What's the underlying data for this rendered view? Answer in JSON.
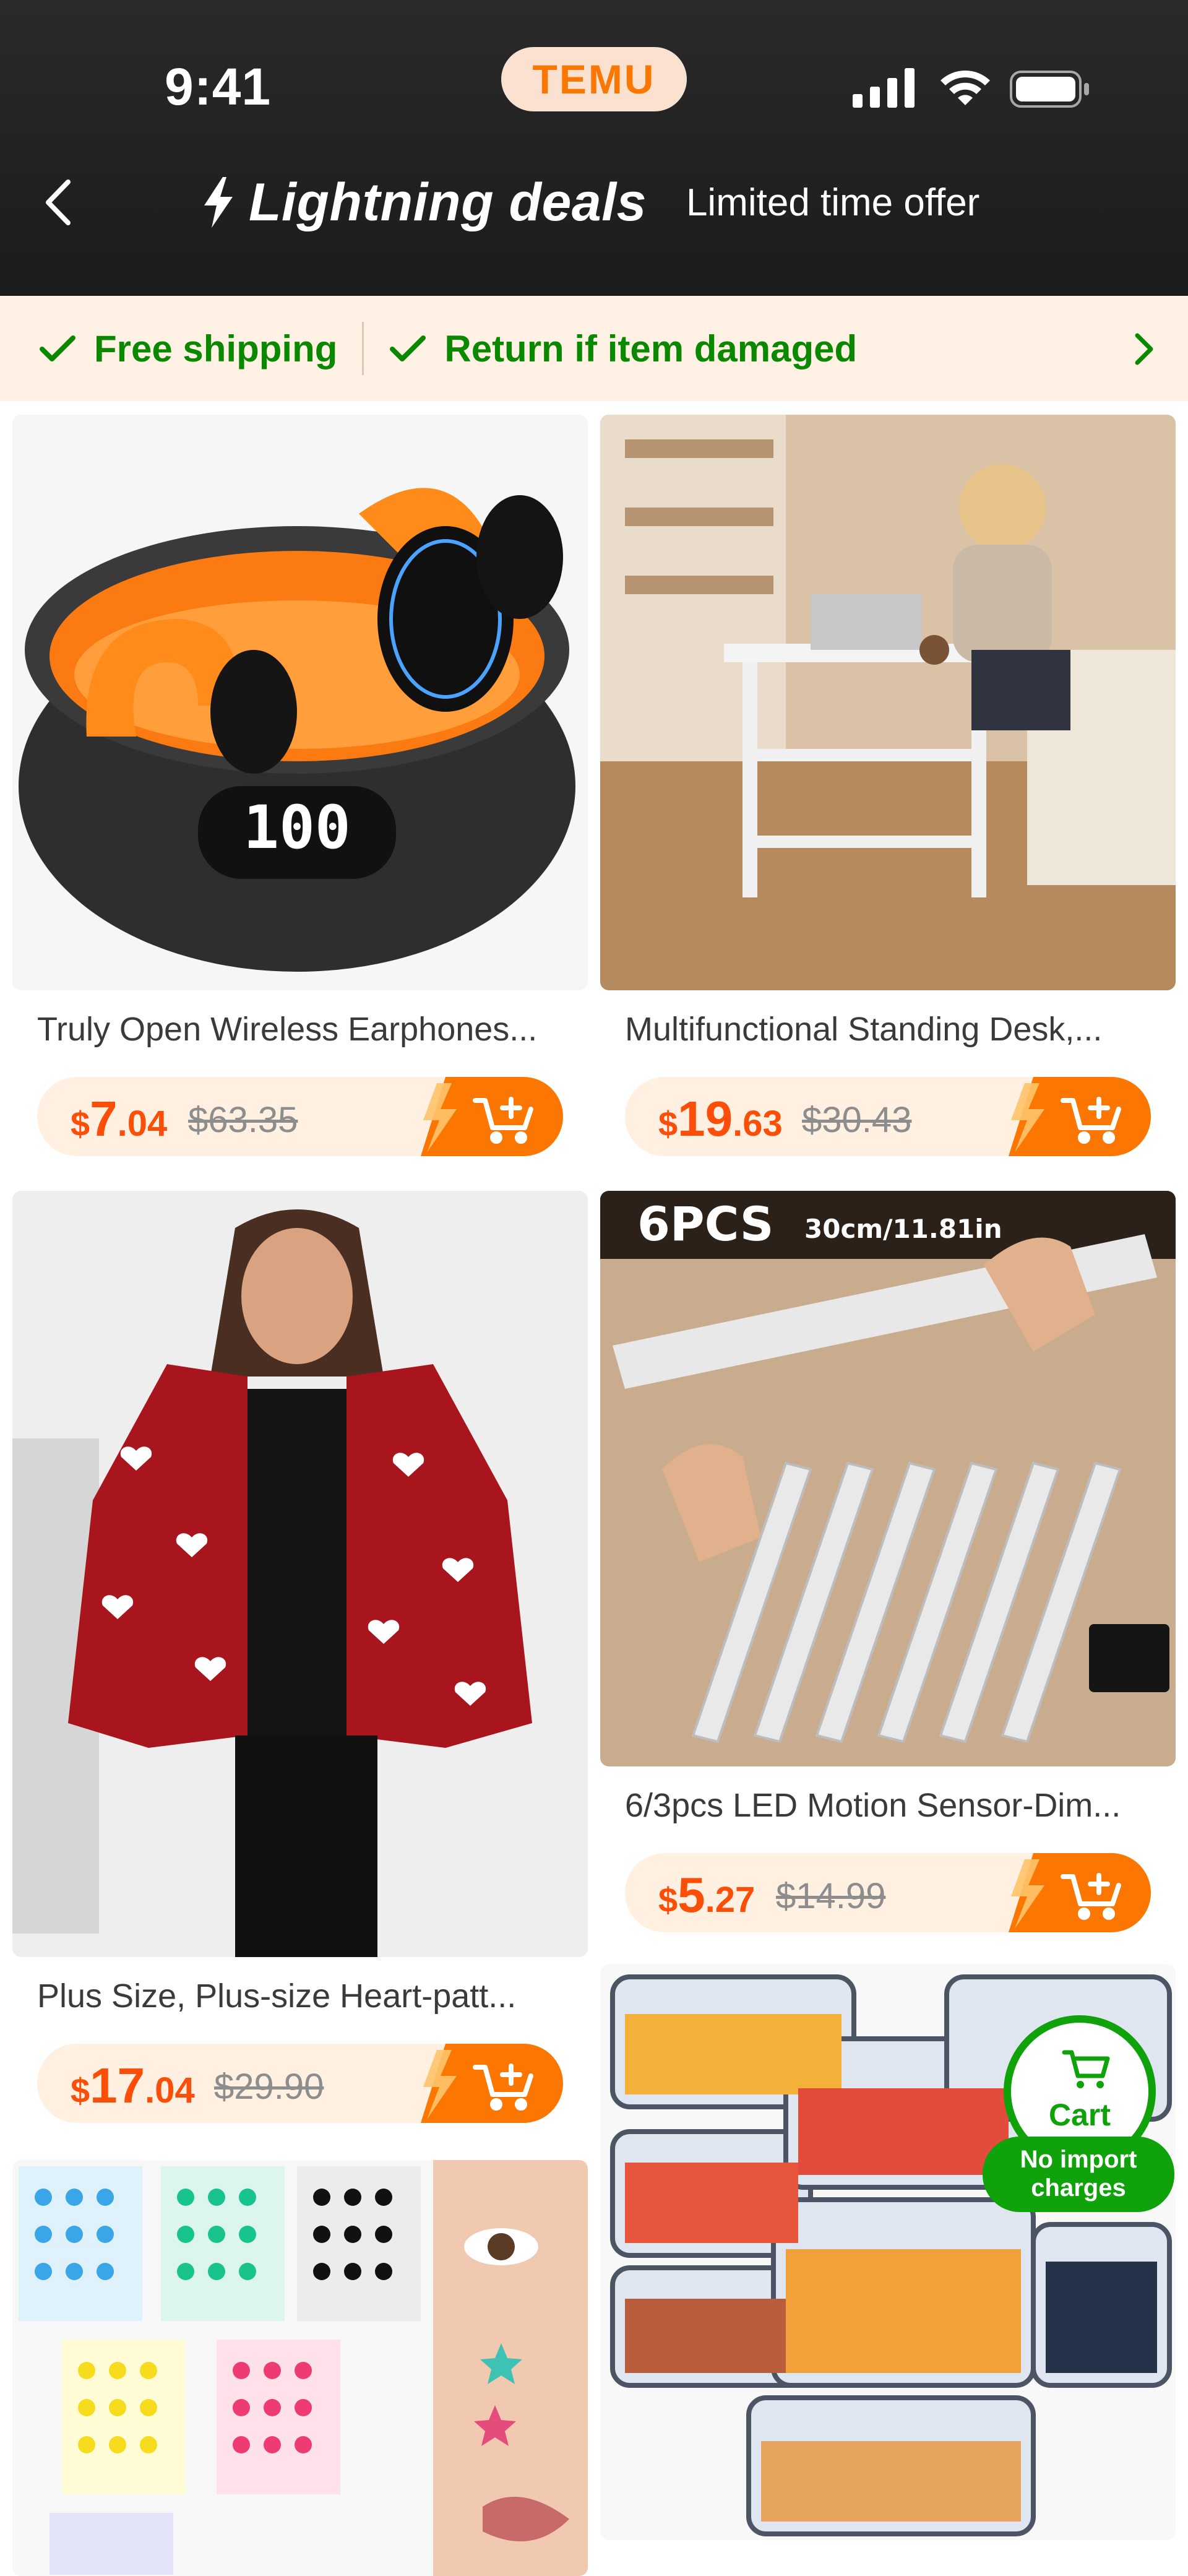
{
  "status_bar": {
    "time": "9:41",
    "brand": "TEMU"
  },
  "header": {
    "title": "Lightning deals",
    "subtitle": "Limited time offer"
  },
  "banner": {
    "item1": "Free shipping",
    "item2": "Return if item damaged"
  },
  "products": [
    {
      "name": "Truly Open Wireless Earphones...",
      "price_currency": "$",
      "price_whole": "7",
      "price_cents": ".04",
      "old_price": "$63.35",
      "image_text": "100"
    },
    {
      "name": "Multifunctional Standing Desk,...",
      "price_currency": "$",
      "price_whole": "19",
      "price_cents": ".63",
      "old_price": "$30.43"
    },
    {
      "name": "Plus Size, Plus-size Heart-patt...",
      "price_currency": "$",
      "price_whole": "17",
      "price_cents": ".04",
      "old_price": "$29.90"
    },
    {
      "name": "6/3pcs LED Motion Sensor-Dim...",
      "price_currency": "$",
      "price_whole": "5",
      "price_cents": ".27",
      "old_price": "$14.99",
      "image_badge": "6PCS",
      "image_size": "30cm/11.81in"
    },
    {
      "name": "",
      "image": "star stickers"
    },
    {
      "name": "",
      "image": "food storage containers"
    }
  ],
  "floating_cart": {
    "label": "Cart",
    "note_line1": "No import",
    "note_line2": "charges"
  },
  "colors": {
    "accent": "#fb7701",
    "price": "#fb4f09",
    "success": "#0fa20a",
    "header_bg": "#1b1b1b",
    "banner_bg": "#fff1e4"
  },
  "icons": [
    "back-chevron-icon",
    "lightning-bolt-icon",
    "checkmark-icon",
    "chevron-right-icon",
    "add-to-cart-icon",
    "signal-icon",
    "wifi-icon",
    "battery-icon"
  ]
}
